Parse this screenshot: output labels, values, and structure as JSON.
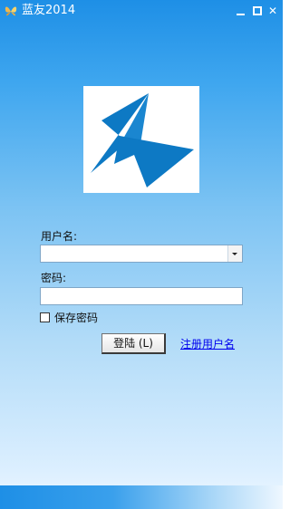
{
  "window": {
    "title": "蓝友2014",
    "icon": "app-butterfly-icon",
    "controls": {
      "minimize_icon": "minimize-icon",
      "maximize_icon": "maximize-icon",
      "close_glyph": "✕"
    }
  },
  "logo": {
    "icon": "blue-swallow-logo-icon",
    "color": "#0d79c4"
  },
  "form": {
    "username_label": "用户名:",
    "username_value": "",
    "password_label": "密码:",
    "password_value": "",
    "remember_label": "保存密码",
    "remember_checked": false,
    "login_button": "登陆 (L)",
    "register_link": "注册用户名"
  },
  "colors": {
    "title_gradient_top": "#1e8fe6",
    "link": "#0000ee"
  }
}
